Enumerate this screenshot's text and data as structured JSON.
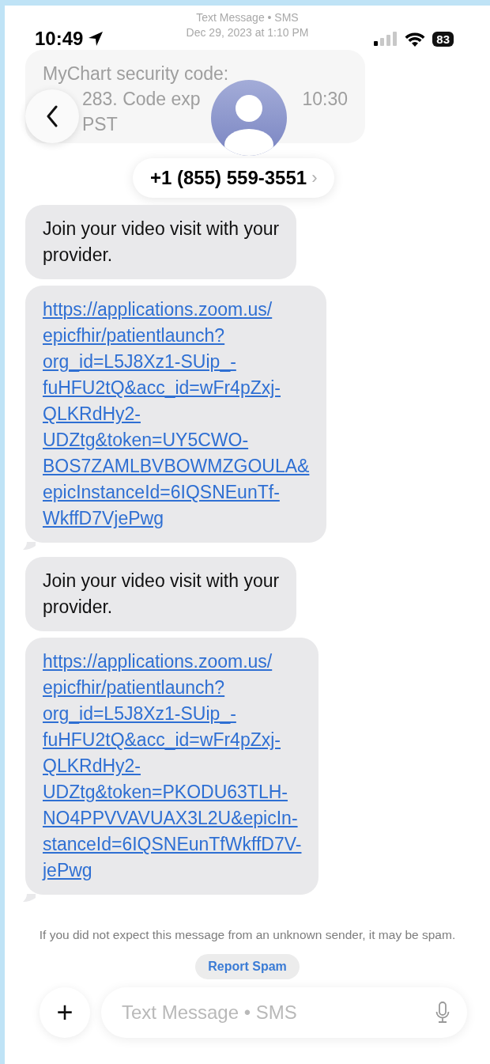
{
  "status_bar": {
    "time": "10:49",
    "battery": "83"
  },
  "faded_header": {
    "title": "Text Message • SMS",
    "date": "Dec 29, 2023 at 1:10 PM"
  },
  "faded_message": {
    "line_1": "MyChart security code:",
    "line_2a": "283.  Code exp",
    "line_2b": "10:30",
    "line_3": "PST"
  },
  "contact": {
    "name": "+1 (855) 559-3551",
    "chevron": "›"
  },
  "messages": [
    {
      "kind": "text",
      "lines": [
        "Join your video visit with your",
        "provider."
      ],
      "tail": false
    },
    {
      "kind": "link",
      "lines": [
        "https://applications.zoom.us/",
        "epicfhir/patientlaunch?",
        "org_id=L5J8Xz1-SUip_-",
        "fuHFU2tQ&acc_id=wFr4pZxj-",
        "QLKRdHy2-",
        "UDZtg&token=UY5CWO-",
        "BOS7ZAMLBVBOWMZGOULA&",
        "epicInstanceId=6IQSNEunTf-",
        "WkffD7VjePwg"
      ],
      "tail": true
    },
    {
      "kind": "text",
      "lines": [
        "Join your video visit with your",
        "provider."
      ],
      "tail": false
    },
    {
      "kind": "link",
      "lines": [
        "https://applications.zoom.us/",
        "epicfhir/patientlaunch?",
        "org_id=L5J8Xz1-SUip_-",
        "fuHFU2tQ&acc_id=wFr4pZxj-",
        "QLKRdHy2-",
        "UDZtg&token=PKODU63TLH-",
        "NO4PPVVAVUAX3L2U&epicIn-",
        "stanceId=6IQSNEunTfWkffD7V-",
        "jePwg"
      ],
      "tail": true
    }
  ],
  "spam_notice": "If you did not expect this message from an unknown sender, it may be spam.",
  "report_button": "Report Spam",
  "composer": {
    "plus": "+",
    "placeholder": "Text Message • SMS"
  }
}
